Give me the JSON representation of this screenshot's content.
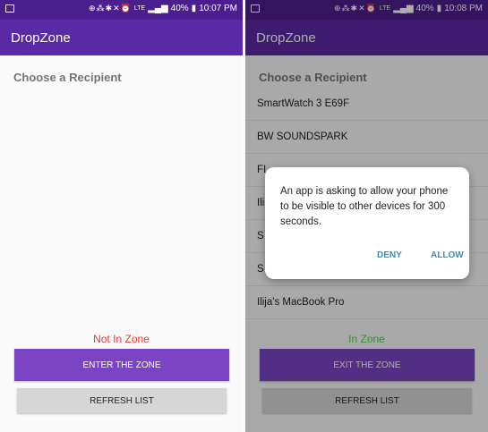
{
  "screens": [
    {
      "status": {
        "battery": "40%",
        "time": "10:07 PM",
        "network": "LTE",
        "icons": "⊕⁂✱✕⏰"
      },
      "app_title": "DropZone",
      "section_title": "Choose a Recipient",
      "zone_status": "Not In Zone",
      "zone_status_color": "#e53935",
      "primary_button": "ENTER THE ZONE",
      "primary_button_color": "#7b44c4",
      "refresh_button": "REFRESH LIST"
    },
    {
      "status": {
        "battery": "40%",
        "time": "10:08 PM",
        "network": "LTE",
        "icons": "⊕⁂✱✕⏰"
      },
      "app_title": "DropZone",
      "section_title": "Choose a Recipient",
      "devices": [
        "SmartWatch 3 E69F",
        "BW SOUNDSPARK",
        "FI",
        "Ili",
        "S",
        "S",
        "Ilija's MacBook Pro"
      ],
      "zone_status": "In Zone",
      "zone_status_color": "#43d843",
      "primary_button": "EXIT THE ZONE",
      "primary_button_color": "#7b44c4",
      "refresh_button": "REFRESH LIST",
      "dialog": {
        "message": "An app is asking to allow your phone to be visible to other devices for 300 seconds.",
        "deny": "DENY",
        "allow": "ALLOW"
      }
    }
  ]
}
